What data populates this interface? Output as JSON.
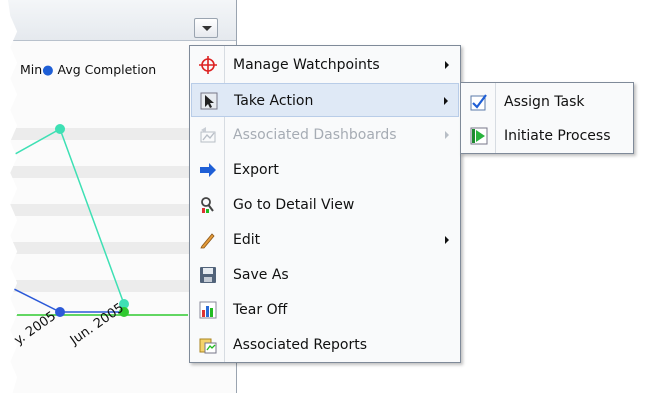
{
  "chart": {
    "legend_left_fragment": "Min",
    "legend_label": "Avg Completion",
    "tick_labels": [
      "y. 2005",
      "Jun. 2005"
    ],
    "colors": {
      "teal": "#3ee0b4",
      "blue": "#2c5ad8",
      "green": "#2fc92f"
    }
  },
  "menu": {
    "items": [
      {
        "label": "Manage Watchpoints",
        "icon": "crosshair-icon",
        "submenu": true,
        "disabled": false
      },
      {
        "label": "Take Action",
        "icon": "cursor-icon",
        "submenu": true,
        "disabled": false,
        "highlighted": true
      },
      {
        "label": "Associated Dashboards",
        "icon": "dashboard-icon",
        "submenu": true,
        "disabled": true
      },
      {
        "label": "Export",
        "icon": "export-arrow-icon",
        "submenu": false,
        "disabled": false
      },
      {
        "label": "Go to Detail View",
        "icon": "detail-view-icon",
        "submenu": false,
        "disabled": false
      },
      {
        "label": "Edit",
        "icon": "pencil-icon",
        "submenu": true,
        "disabled": false
      },
      {
        "label": "Save As",
        "icon": "floppy-disk-icon",
        "submenu": false,
        "disabled": false
      },
      {
        "label": "Tear Off",
        "icon": "tear-off-chart-icon",
        "submenu": false,
        "disabled": false
      },
      {
        "label": "Associated Reports",
        "icon": "reports-icon",
        "submenu": false,
        "disabled": false
      }
    ]
  },
  "submenu": {
    "items": [
      {
        "label": "Assign Task",
        "icon": "checkbox-icon"
      },
      {
        "label": "Initiate Process",
        "icon": "play-process-icon"
      }
    ]
  }
}
